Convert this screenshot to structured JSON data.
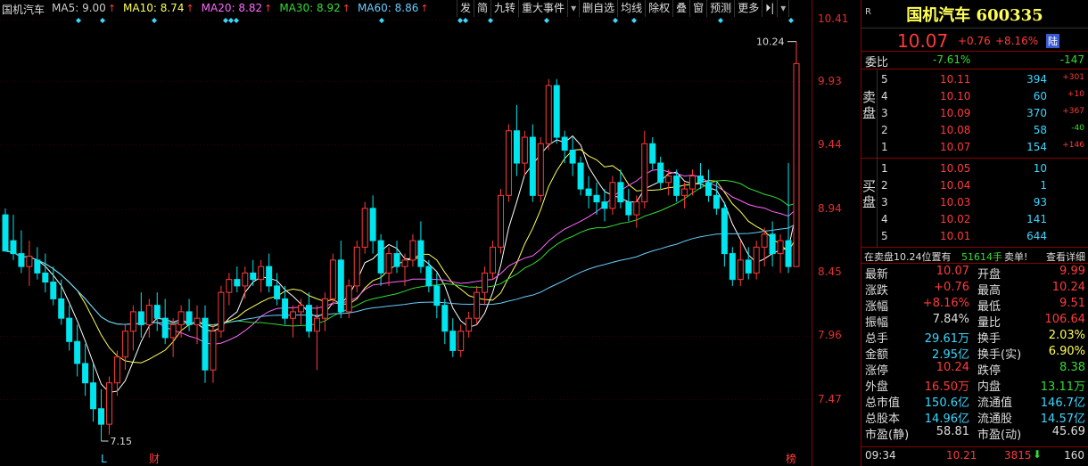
{
  "legend": {
    "name": "国机汽车",
    "ma5": {
      "label": "MA5:",
      "value": "9.00",
      "color": "#ffffff"
    },
    "ma10": {
      "label": "MA10:",
      "value": "8.74",
      "color": "#ffff55"
    },
    "ma20": {
      "label": "MA20:",
      "value": "8.82",
      "color": "#ff66ff"
    },
    "ma30": {
      "label": "MA30:",
      "value": "8.92",
      "color": "#33dd33"
    },
    "ma60": {
      "label": "MA60:",
      "value": "8.86",
      "color": "#66ccff"
    }
  },
  "toolbar": [
    "发",
    "简",
    "九转",
    "重大事件",
    "▾",
    "删自选",
    "均线",
    "除权",
    "叠",
    "窗",
    "预测",
    "更多",
    "⏵|",
    "▾"
  ],
  "yaxis": [
    "10.41",
    "9.93",
    "9.44",
    "8.94",
    "8.45",
    "7.96",
    "7.47"
  ],
  "annotations": {
    "high_label": "10.24",
    "low_label": "7.15",
    "marker_l": "L",
    "marker_cai": "财",
    "marker_bang": "榜"
  },
  "chart_data": {
    "type": "candlestick",
    "ylim": [
      7.15,
      10.41
    ],
    "candles": [
      [
        8.9,
        8.95,
        8.85,
        8.62
      ],
      [
        8.7,
        8.9,
        8.55,
        8.6
      ],
      [
        8.6,
        8.78,
        8.45,
        8.5
      ],
      [
        8.5,
        8.7,
        8.35,
        8.58
      ],
      [
        8.55,
        8.65,
        8.4,
        8.45
      ],
      [
        8.45,
        8.6,
        8.3,
        8.38
      ],
      [
        8.38,
        8.5,
        8.2,
        8.25
      ],
      [
        8.25,
        8.4,
        8.05,
        8.1
      ],
      [
        8.1,
        8.2,
        7.85,
        7.92
      ],
      [
        7.92,
        8.05,
        7.65,
        7.75
      ],
      [
        7.75,
        7.9,
        7.5,
        7.6
      ],
      [
        7.6,
        7.75,
        7.3,
        7.4
      ],
      [
        7.4,
        7.55,
        7.15,
        7.28
      ],
      [
        7.28,
        7.65,
        7.2,
        7.6
      ],
      [
        7.6,
        7.85,
        7.5,
        7.8
      ],
      [
        7.8,
        8.05,
        7.7,
        8.0
      ],
      [
        8.0,
        8.2,
        7.85,
        8.15
      ],
      [
        8.15,
        8.3,
        7.95,
        8.05
      ],
      [
        8.05,
        8.25,
        7.95,
        8.2
      ],
      [
        8.2,
        8.3,
        8.0,
        8.1
      ],
      [
        8.1,
        8.25,
        7.9,
        7.95
      ],
      [
        7.95,
        8.1,
        7.8,
        8.05
      ],
      [
        8.05,
        8.2,
        7.95,
        8.15
      ],
      [
        8.15,
        8.25,
        8.0,
        8.05
      ],
      [
        8.05,
        8.2,
        7.9,
        8.1
      ],
      [
        8.1,
        8.2,
        7.6,
        7.7
      ],
      [
        7.7,
        8.05,
        7.6,
        8.0
      ],
      [
        8.0,
        8.35,
        7.95,
        8.3
      ],
      [
        8.3,
        8.45,
        8.2,
        8.4
      ],
      [
        8.4,
        8.5,
        8.3,
        8.35
      ],
      [
        8.35,
        8.5,
        8.25,
        8.45
      ],
      [
        8.45,
        8.55,
        8.35,
        8.4
      ],
      [
        8.4,
        8.55,
        8.3,
        8.5
      ],
      [
        8.5,
        8.6,
        8.3,
        8.35
      ],
      [
        8.35,
        8.45,
        8.2,
        8.25
      ],
      [
        8.25,
        8.35,
        8.05,
        8.1
      ],
      [
        8.1,
        8.2,
        7.95,
        8.15
      ],
      [
        8.15,
        8.25,
        8.05,
        8.2
      ],
      [
        8.2,
        8.3,
        7.95,
        8.0
      ],
      [
        8.0,
        8.2,
        7.7,
        8.1
      ],
      [
        8.1,
        8.3,
        8.0,
        8.25
      ],
      [
        8.25,
        8.6,
        8.2,
        8.55
      ],
      [
        8.55,
        8.7,
        8.1,
        8.15
      ],
      [
        8.15,
        8.4,
        8.1,
        8.35
      ],
      [
        8.35,
        8.7,
        8.3,
        8.65
      ],
      [
        8.65,
        9.0,
        8.6,
        8.95
      ],
      [
        8.95,
        9.05,
        8.6,
        8.7
      ],
      [
        8.7,
        8.75,
        8.35,
        8.45
      ],
      [
        8.45,
        8.65,
        8.35,
        8.6
      ],
      [
        8.6,
        8.7,
        8.45,
        8.5
      ],
      [
        8.5,
        8.6,
        8.35,
        8.55
      ],
      [
        8.55,
        8.75,
        8.5,
        8.7
      ],
      [
        8.7,
        8.85,
        8.45,
        8.5
      ],
      [
        8.5,
        8.55,
        8.3,
        8.35
      ],
      [
        8.35,
        8.45,
        8.1,
        8.2
      ],
      [
        8.2,
        8.25,
        7.9,
        8.0
      ],
      [
        8.0,
        8.1,
        7.8,
        7.85
      ],
      [
        7.85,
        8.05,
        7.8,
        8.0
      ],
      [
        8.0,
        8.15,
        7.95,
        8.1
      ],
      [
        8.1,
        8.35,
        8.05,
        8.3
      ],
      [
        8.3,
        8.5,
        8.2,
        8.45
      ],
      [
        8.45,
        8.7,
        8.4,
        8.65
      ],
      [
        8.65,
        9.1,
        8.6,
        9.05
      ],
      [
        9.05,
        9.6,
        9.0,
        9.55
      ],
      [
        9.55,
        9.75,
        9.2,
        9.3
      ],
      [
        9.3,
        9.55,
        9.2,
        9.5
      ],
      [
        9.5,
        9.6,
        9.0,
        9.05
      ],
      [
        9.05,
        9.5,
        9.0,
        9.45
      ],
      [
        9.45,
        9.95,
        9.4,
        9.9
      ],
      [
        9.9,
        9.95,
        9.45,
        9.5
      ],
      [
        9.5,
        9.55,
        9.3,
        9.4
      ],
      [
        9.4,
        9.5,
        9.2,
        9.3
      ],
      [
        9.3,
        9.35,
        9.05,
        9.1
      ],
      [
        9.1,
        9.2,
        8.95,
        9.05
      ],
      [
        9.05,
        9.15,
        8.9,
        9.0
      ],
      [
        9.0,
        9.1,
        8.85,
        8.95
      ],
      [
        8.95,
        9.2,
        8.9,
        9.15
      ],
      [
        9.15,
        9.25,
        8.95,
        9.0
      ],
      [
        9.0,
        9.1,
        8.85,
        8.9
      ],
      [
        8.9,
        9.05,
        8.8,
        9.0
      ],
      [
        9.0,
        9.55,
        8.95,
        9.45
      ],
      [
        9.45,
        9.5,
        9.25,
        9.3
      ],
      [
        9.3,
        9.35,
        9.1,
        9.15
      ],
      [
        9.15,
        9.25,
        9.05,
        9.2
      ],
      [
        9.2,
        9.25,
        9.0,
        9.05
      ],
      [
        9.05,
        9.15,
        8.95,
        9.1
      ],
      [
        9.1,
        9.25,
        9.05,
        9.2
      ],
      [
        9.2,
        9.3,
        9.1,
        9.15
      ],
      [
        9.15,
        9.25,
        9.0,
        9.05
      ],
      [
        9.05,
        9.15,
        8.9,
        8.95
      ],
      [
        8.95,
        9.0,
        8.5,
        8.6
      ],
      [
        8.6,
        8.65,
        8.35,
        8.4
      ],
      [
        8.4,
        8.7,
        8.35,
        8.55
      ],
      [
        8.55,
        8.65,
        8.4,
        8.45
      ],
      [
        8.45,
        8.7,
        8.4,
        8.65
      ],
      [
        8.65,
        8.8,
        8.5,
        8.75
      ],
      [
        8.75,
        8.85,
        8.5,
        8.6
      ],
      [
        8.6,
        8.75,
        8.45,
        8.7
      ],
      [
        8.7,
        9.3,
        8.45,
        8.5
      ],
      [
        8.5,
        10.24,
        9.51,
        10.07
      ]
    ]
  },
  "panel": {
    "badge": "R",
    "title": "国机汽车 600335",
    "last": "10.07",
    "change": "+0.76",
    "pct": "+8.16%",
    "lu": "陆",
    "weibi": {
      "label": "委比",
      "pct": "-7.61%",
      "diff": "-147"
    },
    "sell_label": "卖盘",
    "buy_label": "买盘",
    "sell": [
      {
        "lvl": "5",
        "price": "10.11",
        "vol": "394",
        "chg": "+301"
      },
      {
        "lvl": "4",
        "price": "10.10",
        "vol": "60",
        "chg": "+10"
      },
      {
        "lvl": "3",
        "price": "10.09",
        "vol": "370",
        "chg": "+367"
      },
      {
        "lvl": "2",
        "price": "10.08",
        "vol": "58",
        "chg": "-40"
      },
      {
        "lvl": "1",
        "price": "10.07",
        "vol": "154",
        "chg": "+146"
      }
    ],
    "buy": [
      {
        "lvl": "1",
        "price": "10.05",
        "vol": "10",
        "chg": ""
      },
      {
        "lvl": "2",
        "price": "10.04",
        "vol": "1",
        "chg": ""
      },
      {
        "lvl": "3",
        "price": "10.03",
        "vol": "93",
        "chg": ""
      },
      {
        "lvl": "4",
        "price": "10.02",
        "vol": "141",
        "chg": ""
      },
      {
        "lvl": "5",
        "price": "10.01",
        "vol": "644",
        "chg": ""
      }
    ],
    "notice": {
      "a": "在卖盘10.24位置有",
      "b": "51614手",
      "c": "卖单!",
      "d": "查看详细"
    },
    "stats": [
      [
        "最新",
        "10.07",
        "red",
        "开盘",
        "9.99",
        "red"
      ],
      [
        "涨跌",
        "+0.76",
        "red",
        "最高",
        "10.24",
        "red"
      ],
      [
        "涨幅",
        "+8.16%",
        "red",
        "最低",
        "9.51",
        "red"
      ],
      [
        "振幅",
        "7.84%",
        "white",
        "量比",
        "106.64",
        "red"
      ],
      [
        "总手",
        "29.61万",
        "cyan",
        "换手",
        "2.03%",
        "yellow"
      ],
      [
        "金额",
        "2.95亿",
        "cyan",
        "换手(实)",
        "6.90%",
        "yellow"
      ],
      [
        "涨停",
        "10.24",
        "red",
        "跌停",
        "8.38",
        "green"
      ],
      [
        "外盘",
        "16.50万",
        "red",
        "内盘",
        "13.11万",
        "green"
      ],
      [
        "总市值",
        "150.6亿",
        "cyan",
        "流通值",
        "146.7亿",
        "cyan"
      ],
      [
        "总股本",
        "14.96亿",
        "cyan",
        "流通股",
        "14.57亿",
        "cyan"
      ],
      [
        "市盈(静)",
        "58.81",
        "white",
        "市盈(动)",
        "45.69",
        "white"
      ]
    ],
    "tick": {
      "time": "09:34",
      "price": "10.21",
      "vol": "3815",
      "count": "160"
    }
  }
}
